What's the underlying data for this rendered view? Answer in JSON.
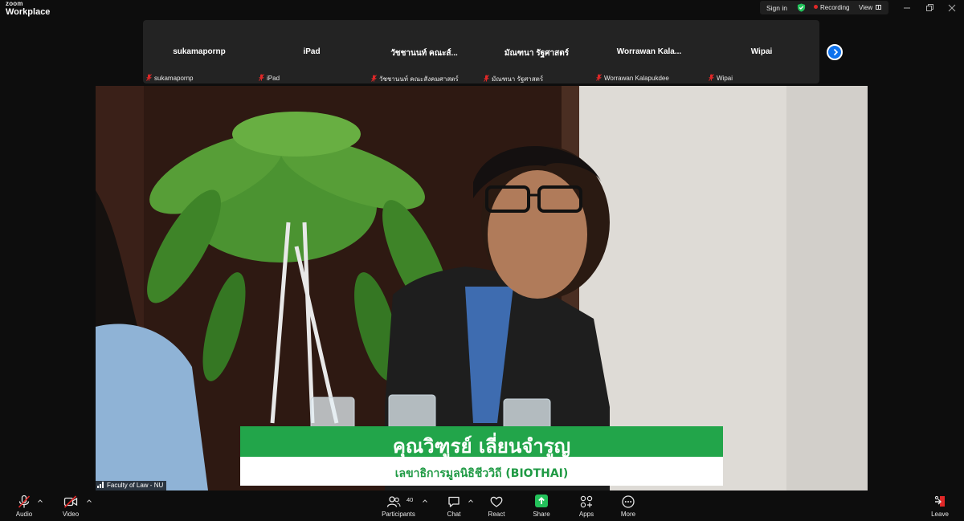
{
  "app": {
    "logo_top": "zoom",
    "logo_bottom": "Workplace"
  },
  "titlebar": {
    "sign_in": "Sign in",
    "recording": "Recording",
    "view": "View",
    "icons": [
      "shield-check-icon",
      "recording-dot-icon",
      "grid-view-icon",
      "minimize-icon",
      "restore-icon",
      "close-icon"
    ]
  },
  "participants": [
    {
      "tile_name": "sukamapornp",
      "foot_name": "sukamapornp"
    },
    {
      "tile_name": "iPad",
      "foot_name": "iPad"
    },
    {
      "tile_name": "วัชชานนท์ คณะส์...",
      "foot_name": "วัชชานนท์ คณะสังคมศาสตร์"
    },
    {
      "tile_name": "มัณฑนา รัฐศาสตร์",
      "foot_name": "มัณฑนา รัฐศาสตร์"
    },
    {
      "tile_name": "Worrawan  Kala...",
      "foot_name": "Worrawan Kalapukdee"
    },
    {
      "tile_name": "Wipai",
      "foot_name": "Wipai"
    }
  ],
  "video": {
    "speaker_name": "คุณวิฑูรย์ เลี่ยนจำรูญ",
    "speaker_title": "เลขาธิการมูลนิธิชีววิถี (BIOTHAI)",
    "label": "Faculty of Law - NU",
    "colors": {
      "banner_green": "#22a54a",
      "banner_text_green": "#1f9a44"
    }
  },
  "toolbar": {
    "audio": "Audio",
    "video": "Video",
    "participants": "Participants",
    "participant_count": "40",
    "chat": "Chat",
    "react": "React",
    "share": "Share",
    "apps": "Apps",
    "more": "More",
    "leave": "Leave",
    "colors": {
      "share_green": "#23c15a",
      "muted_red": "#e02828"
    }
  }
}
